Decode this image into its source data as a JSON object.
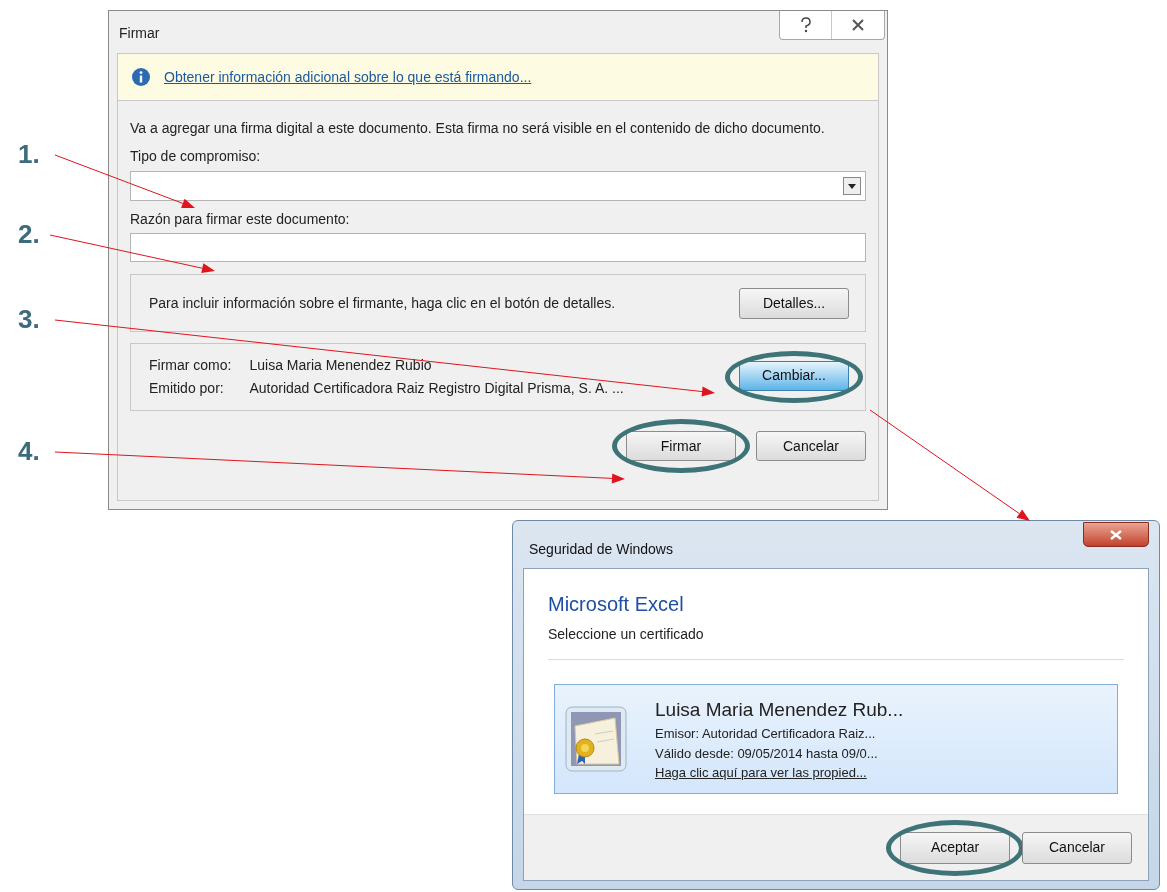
{
  "annotations": [
    {
      "label": "1."
    },
    {
      "label": "2."
    },
    {
      "label": "3."
    },
    {
      "label": "4."
    }
  ],
  "firmar_dialog": {
    "title": "Firmar",
    "info_link": "Obtener información adicional sobre lo que está firmando...",
    "description": "Va a agregar una firma digital a este documento. Esta firma no será visible en el contenido de dicho documento.",
    "commitment_type": {
      "label": "Tipo de compromiso:"
    },
    "reason": {
      "label": "Razón para firmar este documento:"
    },
    "details_group": {
      "text": "Para incluir información sobre el firmante, haga clic en el botón de detalles.",
      "button": {
        "label": "Detalles...",
        "highlighted": false,
        "hovered": false
      }
    },
    "signer_group": {
      "rows": [
        {
          "label": "Firmar como:",
          "value": "Luisa Maria Menendez Rubio"
        },
        {
          "label": "Emitido por:",
          "value": "Autoridad Certificadora Raiz Registro Digital Prisma, S. A. ..."
        }
      ],
      "button": {
        "label": "Cambiar...",
        "highlighted": true,
        "hovered": true
      }
    },
    "buttons": [
      {
        "label": "Firmar",
        "highlighted": true,
        "hovered": false
      },
      {
        "label": "Cancelar",
        "highlighted": false,
        "hovered": false
      }
    ]
  },
  "security_dialog": {
    "title": "Seguridad de Windows",
    "app_name": "Microsoft Excel",
    "instruction": "Seleccione un certificado",
    "certificate": {
      "name": "Luisa Maria Menendez Rub...",
      "issuer": "Emisor: Autoridad Certificadora Raiz...",
      "validity": "Válido desde: 09/05/2014 hasta 09/0...",
      "properties_link": "Haga clic aquí para ver las propied..."
    },
    "buttons": [
      {
        "label": "Aceptar",
        "highlighted": true,
        "hovered": false
      },
      {
        "label": "Cancelar",
        "highlighted": false,
        "hovered": false
      }
    ]
  }
}
